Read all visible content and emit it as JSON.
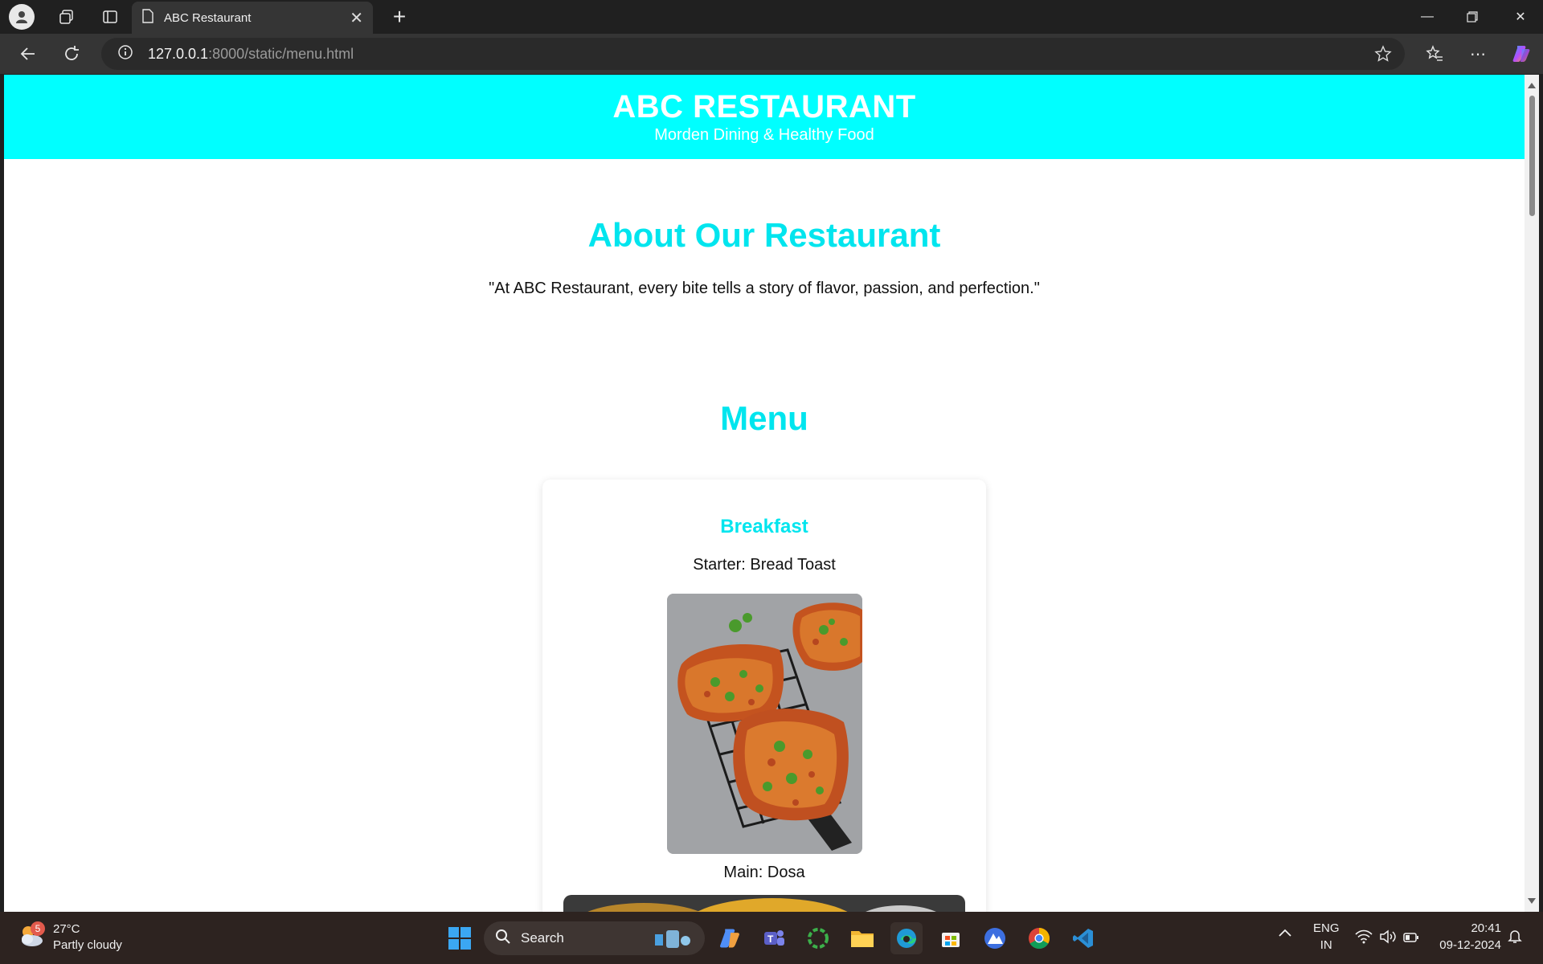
{
  "browser": {
    "tab_title": "ABC Restaurant",
    "url_host": "127.0.0.1",
    "url_rest": ":8000/static/menu.html"
  },
  "page": {
    "header_title": "ABC RESTAURANT",
    "header_subtitle": "Morden Dining & Healthy Food",
    "about_heading": "About Our Restaurant",
    "about_text": "\"At ABC Restaurant, every bite tells a story of flavor, passion, and perfection.\"",
    "menu_heading": "Menu",
    "card": {
      "meal": "Breakfast",
      "starter": "Starter: Bread Toast",
      "main": "Main: Dosa"
    }
  },
  "taskbar": {
    "weather_temp": "27°C",
    "weather_desc": "Partly cloudy",
    "weather_badge": "5",
    "search_label": "Search",
    "lang_top": "ENG",
    "lang_bottom": "IN",
    "time": "20:41",
    "date": "09-12-2024"
  },
  "colors": {
    "accent": "#00FFFF",
    "heading": "#00E5EE"
  }
}
